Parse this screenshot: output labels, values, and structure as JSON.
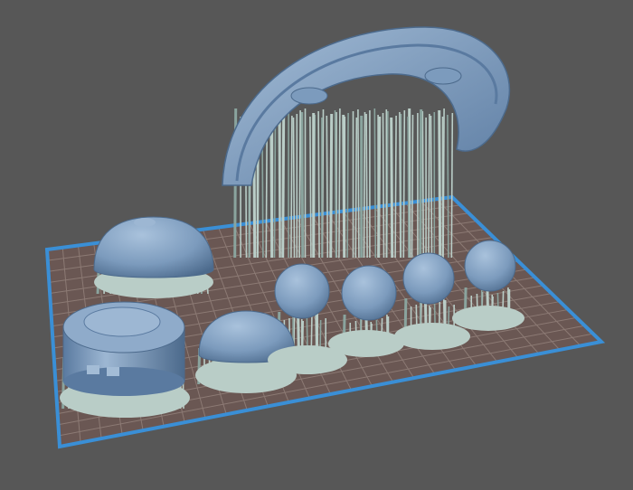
{
  "viewport": {
    "background_color": "#575757",
    "plate_color": "#6a5753",
    "plate_grid_color": "#8c7a74",
    "plate_border_color": "#3a8fd6",
    "model_color": "#7c9bbd",
    "model_shadow_color": "#4c6a8c",
    "support_color": "#b9cdc7",
    "support_shadow_color": "#8aa49e"
  },
  "scene": {
    "objects": [
      {
        "name": "arch-gate",
        "kind": "arch"
      },
      {
        "name": "dome-large-back",
        "kind": "dome"
      },
      {
        "name": "dome-cylinder-front",
        "kind": "cylinder"
      },
      {
        "name": "dome-medium-front",
        "kind": "dome"
      },
      {
        "name": "sphere-1",
        "kind": "sphere"
      },
      {
        "name": "sphere-2",
        "kind": "sphere"
      },
      {
        "name": "sphere-3",
        "kind": "sphere"
      },
      {
        "name": "sphere-4",
        "kind": "sphere"
      }
    ]
  }
}
